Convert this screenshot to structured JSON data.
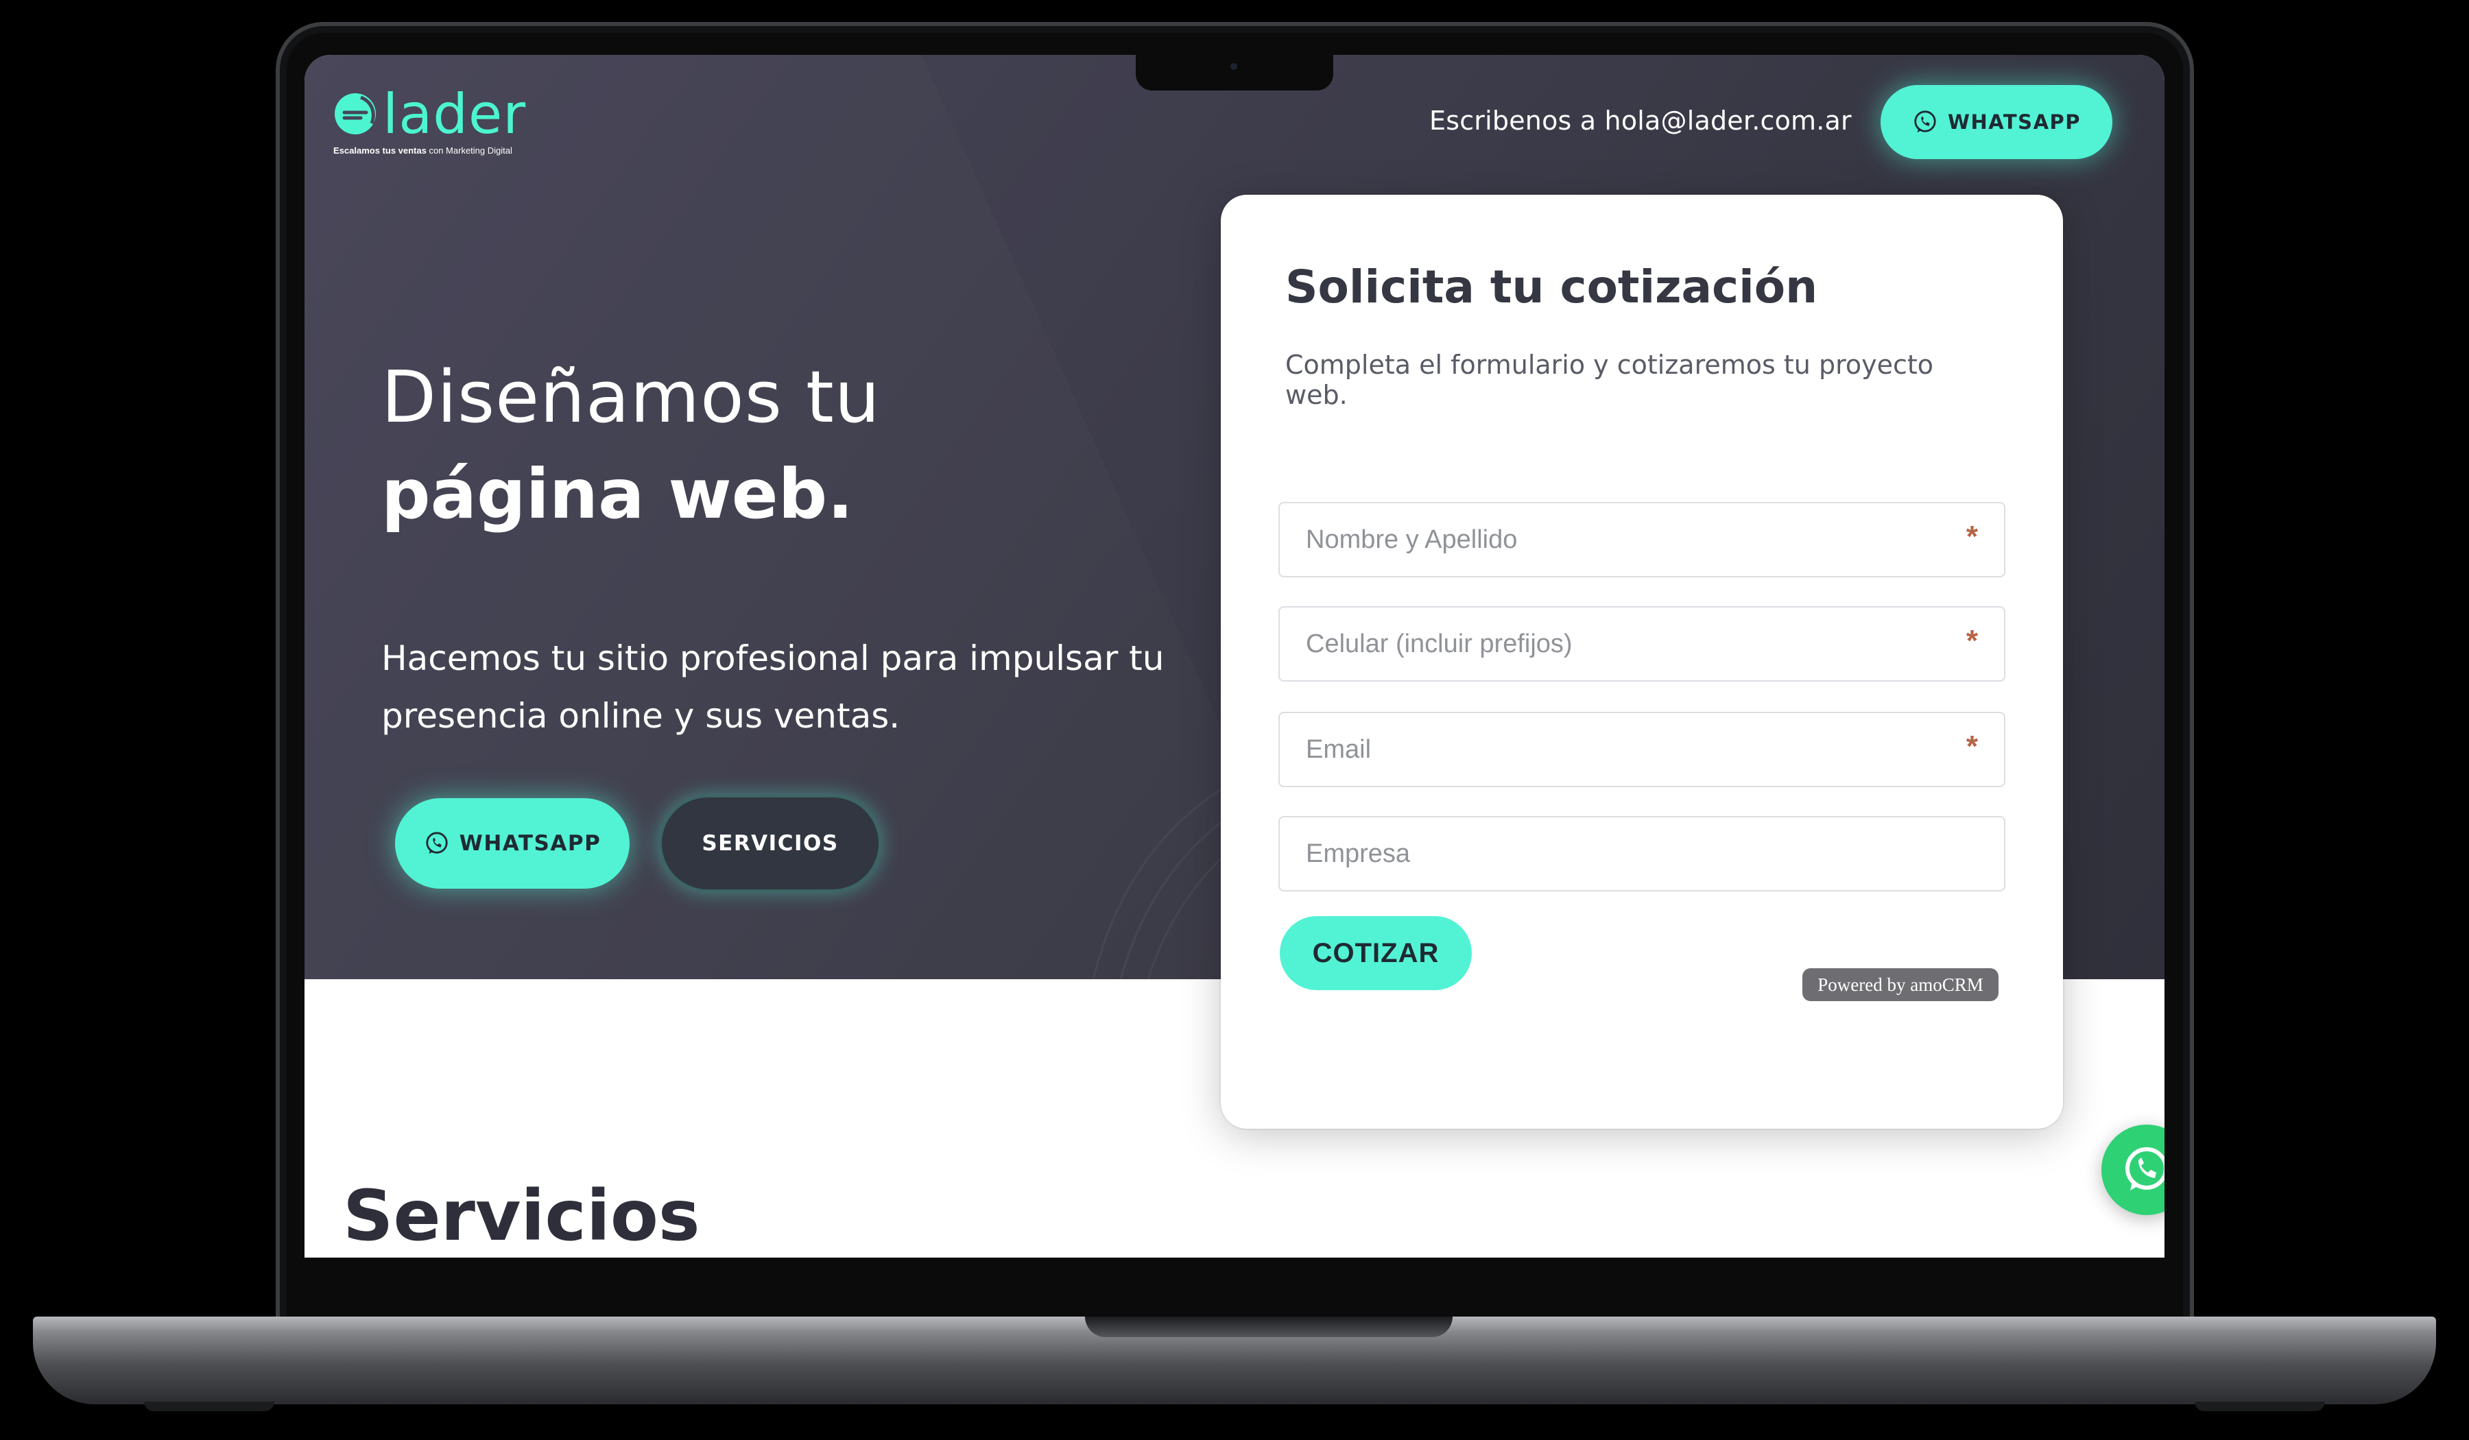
{
  "brand": {
    "name": "lader",
    "tagline_bold": "Escalamos tus ventas",
    "tagline_rest": "con Marketing Digital",
    "accent_color": "#52f3d4",
    "hero_bg_color": "#3e3d4c"
  },
  "nav": {
    "email_text": "Escribenos a hola@lader.com.ar",
    "whatsapp_label": "WHATSAPP",
    "whatsapp_icon": "whatsapp-icon"
  },
  "hero": {
    "title_light": "Diseñamos tu",
    "title_bold": "página web.",
    "subtitle": "Hacemos tu sitio profesional para impulsar tu presencia online y sus ventas.",
    "whatsapp_label": "WHATSAPP",
    "servicios_label": "SERVICIOS"
  },
  "form": {
    "title": "Solicita tu cotización",
    "description": "Completa el formulario y cotizaremos tu proyecto web.",
    "fields": [
      {
        "placeholder": "Nombre y Apellido",
        "required_mark": "*"
      },
      {
        "placeholder": "Celular (incluir prefijos)",
        "required_mark": "*"
      },
      {
        "placeholder": "Email",
        "required_mark": "*"
      },
      {
        "placeholder": "Empresa",
        "required_mark": ""
      }
    ],
    "submit_label": "COTIZAR",
    "powered_by": "Powered by amoCRM"
  },
  "sections": {
    "servicios_title": "Servicios"
  },
  "floating": {
    "whatsapp_icon": "whatsapp-icon",
    "color": "#2fd175"
  }
}
